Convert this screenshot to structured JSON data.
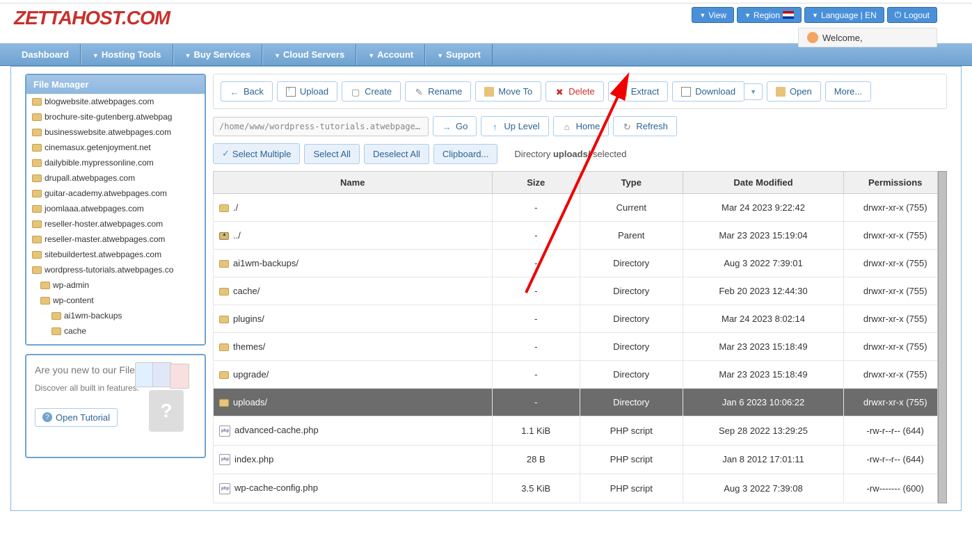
{
  "logo": "ZETTAHOST.COM",
  "topbar": {
    "view": "View",
    "region": "Region",
    "language": "Language | EN",
    "logout": "Logout"
  },
  "welcome": "Welcome,",
  "nav": {
    "dashboard": "Dashboard",
    "hosting": "Hosting Tools",
    "buy": "Buy Services",
    "cloud": "Cloud Servers",
    "account": "Account",
    "support": "Support"
  },
  "sidebar": {
    "title": "File Manager",
    "tree": [
      {
        "label": "blogwebsite.atwebpages.com",
        "indent": 0
      },
      {
        "label": "brochure-site-gutenberg.atwebpages.com",
        "indent": 0,
        "bold": false,
        "trunc": "brochure-site-gutenberg.atwebpag"
      },
      {
        "label": "businesswebsite.atwebpages.com",
        "indent": 0
      },
      {
        "label": "cinemasux.getenjoyment.net",
        "indent": 0
      },
      {
        "label": "dailybible.mypressonline.com",
        "indent": 0
      },
      {
        "label": "drupall.atwebpages.com",
        "indent": 0
      },
      {
        "label": "guitar-academy.atwebpages.com",
        "indent": 0
      },
      {
        "label": "joomlaaa.atwebpages.com",
        "indent": 0
      },
      {
        "label": "reseller-hoster.atwebpages.com",
        "indent": 0
      },
      {
        "label": "reseller-master.atwebpages.com",
        "indent": 0
      },
      {
        "label": "sitebuildertest.atwebpages.com",
        "indent": 0
      },
      {
        "label": "wordpress-tutorials.atwebpages.com",
        "indent": 0,
        "trunc": "wordpress-tutorials.atwebpages.co"
      },
      {
        "label": "wp-admin",
        "indent": 1
      },
      {
        "label": "wp-content",
        "indent": 1
      },
      {
        "label": "ai1wm-backups",
        "indent": 2
      },
      {
        "label": "cache",
        "indent": 2
      }
    ]
  },
  "info_panel": {
    "title": "Are you new to our File Manager?",
    "sub": "Discover all built in features.",
    "button": "Open Tutorial"
  },
  "toolbar": {
    "back": "Back",
    "upload": "Upload",
    "create": "Create",
    "rename": "Rename",
    "move": "Move To",
    "delete": "Delete",
    "extract": "Extract",
    "download": "Download",
    "open": "Open",
    "more": "More..."
  },
  "path": {
    "value": "/home/www/wordpress-tutorials.atwebpages.com/wp-content",
    "display": "/home/www/wordpress-tutorials.atwebpages.com/wp-con",
    "go": "Go",
    "up": "Up Level",
    "home": "Home",
    "refresh": "Refresh"
  },
  "selection": {
    "multiple": "Select Multiple",
    "all": "Select All",
    "deselect": "Deselect All",
    "clipboard": "Clipboard...",
    "info_prefix": "Directory ",
    "info_dir": "uploads/",
    "info_suffix": " selected"
  },
  "columns": {
    "name": "Name",
    "size": "Size",
    "type": "Type",
    "date": "Date Modified",
    "perm": "Permissions"
  },
  "rows": [
    {
      "icon": "folder",
      "name": "./",
      "size": "-",
      "type": "Current",
      "date": "Mar 24 2023 9:22:42",
      "perm": "drwxr-xr-x (755)"
    },
    {
      "icon": "up",
      "name": "../",
      "size": "-",
      "type": "Parent",
      "date": "Mar 23 2023 15:19:04",
      "perm": "drwxr-xr-x (755)"
    },
    {
      "icon": "folder",
      "name": "ai1wm-backups/",
      "size": "-",
      "type": "Directory",
      "date": "Aug 3 2022 7:39:01",
      "perm": "drwxr-xr-x (755)"
    },
    {
      "icon": "folder",
      "name": "cache/",
      "size": "-",
      "type": "Directory",
      "date": "Feb 20 2023 12:44:30",
      "perm": "drwxr-xr-x (755)"
    },
    {
      "icon": "folder",
      "name": "plugins/",
      "size": "-",
      "type": "Directory",
      "date": "Mar 24 2023 8:02:14",
      "perm": "drwxr-xr-x (755)"
    },
    {
      "icon": "folder",
      "name": "themes/",
      "size": "-",
      "type": "Directory",
      "date": "Mar 23 2023 15:18:49",
      "perm": "drwxr-xr-x (755)"
    },
    {
      "icon": "folder",
      "name": "upgrade/",
      "size": "-",
      "type": "Directory",
      "date": "Mar 23 2023 15:18:49",
      "perm": "drwxr-xr-x (755)"
    },
    {
      "icon": "folder",
      "name": "uploads/",
      "size": "-",
      "type": "Directory",
      "date": "Jan 6 2023 10:06:22",
      "perm": "drwxr-xr-x (755)",
      "selected": true
    },
    {
      "icon": "php",
      "name": "advanced-cache.php",
      "size": "1.1 KiB",
      "type": "PHP script",
      "date": "Sep 28 2022 13:29:25",
      "perm": "-rw-r--r-- (644)"
    },
    {
      "icon": "php",
      "name": "index.php",
      "size": "28 B",
      "type": "PHP script",
      "date": "Jan 8 2012 17:01:11",
      "perm": "-rw-r--r-- (644)"
    },
    {
      "icon": "php",
      "name": "wp-cache-config.php",
      "size": "3.5 KiB",
      "type": "PHP script",
      "date": "Aug 3 2022 7:39:08",
      "perm": "-rw------- (600)"
    }
  ]
}
